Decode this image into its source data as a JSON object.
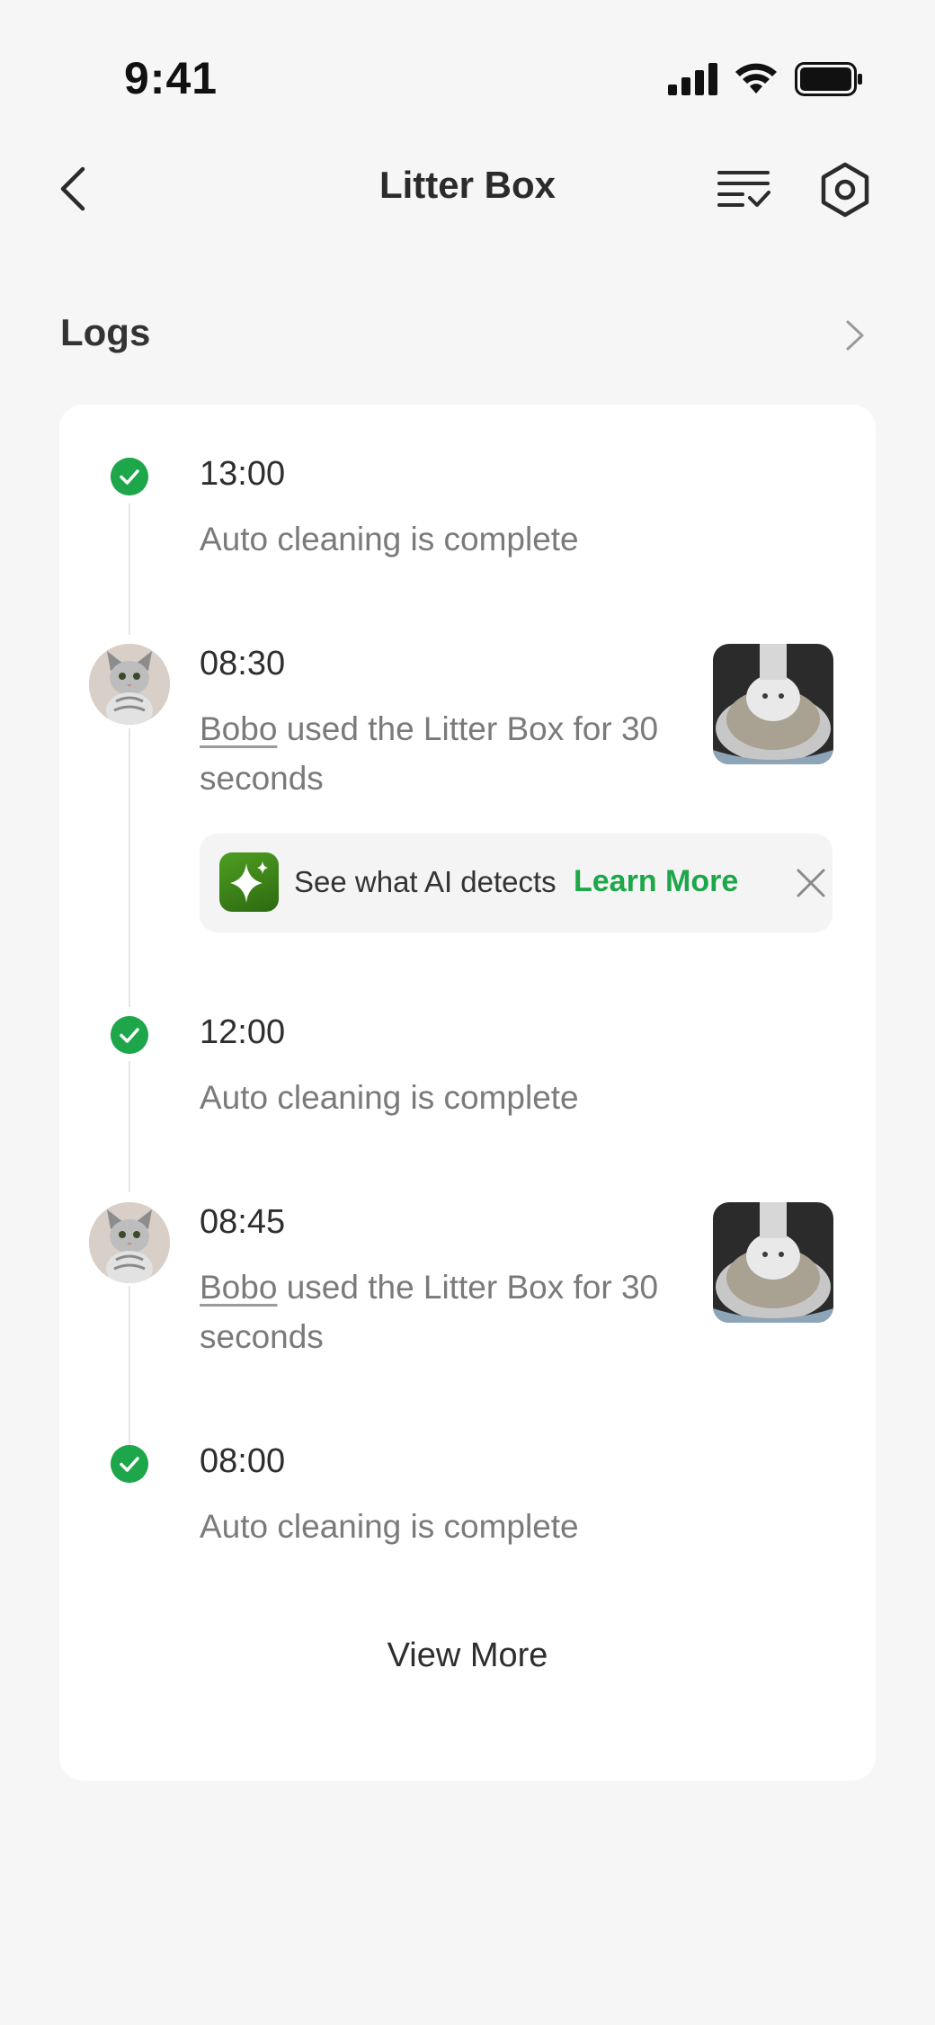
{
  "status_bar": {
    "time": "9:41"
  },
  "header": {
    "title": "Litter Box"
  },
  "logs": {
    "title": "Logs",
    "entries": [
      {
        "time": "13:00",
        "text": "Auto cleaning is complete"
      },
      {
        "time": "08:30",
        "pet": "Bobo",
        "text": " used the Litter Box for 30 seconds"
      },
      {
        "time": "12:00",
        "text": "Auto cleaning is complete"
      },
      {
        "time": "08:45",
        "pet": "Bobo",
        "text": " used the Litter Box for 30 seconds"
      },
      {
        "time": "08:00",
        "text": "Auto cleaning is complete"
      }
    ],
    "ai_banner": {
      "text": "See what AI detects",
      "link": "Learn More"
    },
    "view_more": "View More"
  },
  "colors": {
    "accent": "#1ea64a",
    "background": "#f6f6f6",
    "card": "#ffffff"
  }
}
